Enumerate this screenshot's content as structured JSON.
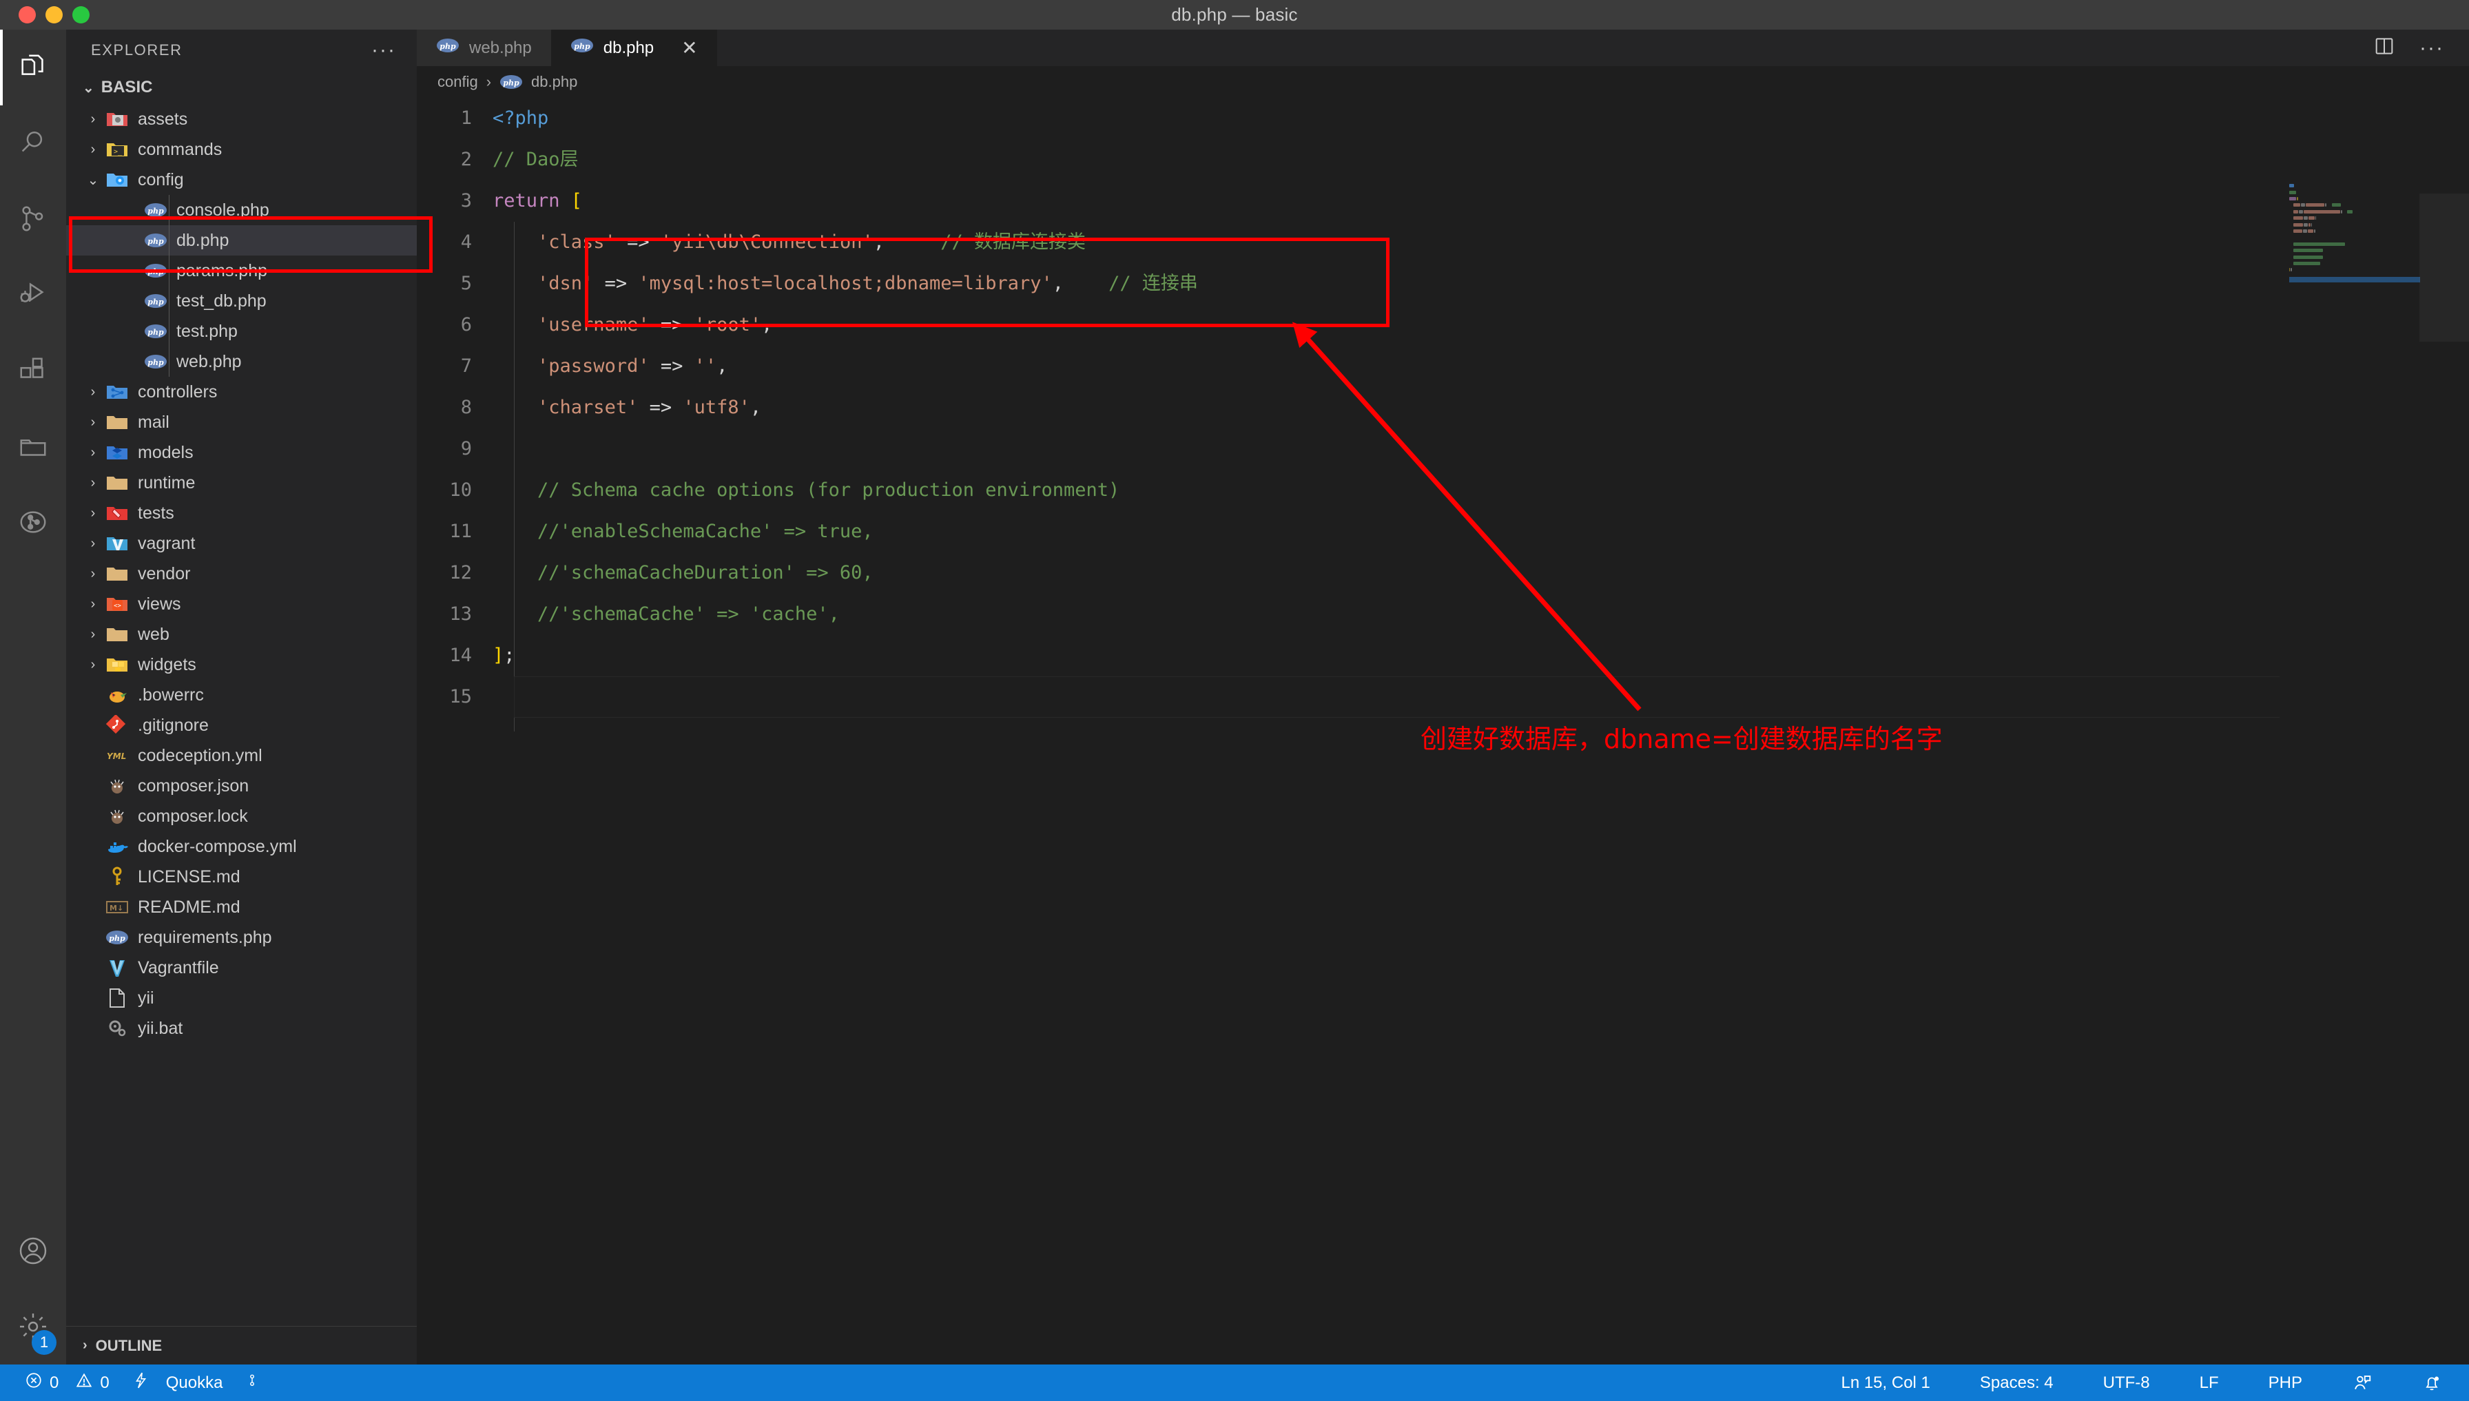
{
  "window": {
    "title": "db.php — basic",
    "traffic_lights": [
      "close",
      "minimize",
      "zoom"
    ]
  },
  "activity_bar": {
    "items": [
      {
        "name": "explorer",
        "icon": "files-icon",
        "active": true
      },
      {
        "name": "search",
        "icon": "search-icon",
        "active": false
      },
      {
        "name": "source-control",
        "icon": "source-control-icon",
        "active": false
      },
      {
        "name": "run-and-debug",
        "icon": "run-debug-icon",
        "active": false
      },
      {
        "name": "extensions",
        "icon": "extensions-icon",
        "active": false
      },
      {
        "name": "file-browser",
        "icon": "folder-icon",
        "active": false
      },
      {
        "name": "git-graph",
        "icon": "git-graph-icon",
        "active": false
      }
    ],
    "bottom_items": [
      {
        "name": "accounts",
        "icon": "account-icon"
      },
      {
        "name": "manage-settings",
        "icon": "gear-icon",
        "badge": "1"
      }
    ]
  },
  "sidebar": {
    "header_label": "EXPLORER",
    "more_actions": "···",
    "section_label": "BASIC",
    "section_chevron": "⌄",
    "outline_label": "OUTLINE",
    "outline_chevron": "›",
    "tree": [
      {
        "label": "assets",
        "type": "folder",
        "depth": 1,
        "chevron": "›",
        "icon": "assets-folder-icon",
        "color": "#e05252"
      },
      {
        "label": "commands",
        "type": "folder",
        "depth": 1,
        "chevron": "›",
        "icon": "commands-folder-icon",
        "color": "#e8c547"
      },
      {
        "label": "config",
        "type": "folder",
        "depth": 1,
        "chevron": "⌄",
        "icon": "config-folder-icon",
        "color": "#64b5f6"
      },
      {
        "label": "console.php",
        "type": "file",
        "depth": 2,
        "chevron": "",
        "icon": "php-icon",
        "color": "#6181b6"
      },
      {
        "label": "db.php",
        "type": "file",
        "depth": 2,
        "chevron": "",
        "icon": "php-icon",
        "color": "#6181b6",
        "selected": true
      },
      {
        "label": "params.php",
        "type": "file",
        "depth": 2,
        "chevron": "",
        "icon": "php-icon",
        "color": "#6181b6"
      },
      {
        "label": "test_db.php",
        "type": "file",
        "depth": 2,
        "chevron": "",
        "icon": "php-icon",
        "color": "#6181b6"
      },
      {
        "label": "test.php",
        "type": "file",
        "depth": 2,
        "chevron": "",
        "icon": "php-icon",
        "color": "#6181b6"
      },
      {
        "label": "web.php",
        "type": "file",
        "depth": 2,
        "chevron": "",
        "icon": "php-icon",
        "color": "#6181b6"
      },
      {
        "label": "controllers",
        "type": "folder",
        "depth": 1,
        "chevron": "›",
        "icon": "controllers-folder-icon",
        "color": "#4a90d9"
      },
      {
        "label": "mail",
        "type": "folder",
        "depth": 1,
        "chevron": "›",
        "icon": "folder-icon",
        "color": "#dcb67a"
      },
      {
        "label": "models",
        "type": "folder",
        "depth": 1,
        "chevron": "›",
        "icon": "models-folder-icon",
        "color": "#3a7bd5"
      },
      {
        "label": "runtime",
        "type": "folder",
        "depth": 1,
        "chevron": "›",
        "icon": "folder-icon",
        "color": "#dcb67a"
      },
      {
        "label": "tests",
        "type": "folder",
        "depth": 1,
        "chevron": "›",
        "icon": "tests-folder-icon",
        "color": "#e53935"
      },
      {
        "label": "vagrant",
        "type": "folder",
        "depth": 1,
        "chevron": "›",
        "icon": "vagrant-folder-icon",
        "color": "#3fa2d6"
      },
      {
        "label": "vendor",
        "type": "folder",
        "depth": 1,
        "chevron": "›",
        "icon": "folder-icon",
        "color": "#dcb67a"
      },
      {
        "label": "views",
        "type": "folder",
        "depth": 1,
        "chevron": "›",
        "icon": "views-folder-icon",
        "color": "#e8603c"
      },
      {
        "label": "web",
        "type": "folder",
        "depth": 1,
        "chevron": "›",
        "icon": "folder-icon",
        "color": "#dcb67a"
      },
      {
        "label": "widgets",
        "type": "folder",
        "depth": 1,
        "chevron": "›",
        "icon": "widgets-folder-icon",
        "color": "#f0c040"
      },
      {
        "label": ".bowerrc",
        "type": "file",
        "depth": 1,
        "chevron": "",
        "icon": "bower-icon",
        "color": "#ef5734"
      },
      {
        "label": ".gitignore",
        "type": "file",
        "depth": 1,
        "chevron": "",
        "icon": "git-icon",
        "color": "#e8432f"
      },
      {
        "label": "codeception.yml",
        "type": "file",
        "depth": 1,
        "chevron": "",
        "icon": "yaml-icon",
        "color": "#cfa847"
      },
      {
        "label": "composer.json",
        "type": "file",
        "depth": 1,
        "chevron": "",
        "icon": "composer-icon",
        "color": "#886a54"
      },
      {
        "label": "composer.lock",
        "type": "file",
        "depth": 1,
        "chevron": "",
        "icon": "composer-icon",
        "color": "#886a54"
      },
      {
        "label": "docker-compose.yml",
        "type": "file",
        "depth": 1,
        "chevron": "",
        "icon": "docker-icon",
        "color": "#2496ed"
      },
      {
        "label": "LICENSE.md",
        "type": "file",
        "depth": 1,
        "chevron": "",
        "icon": "key-icon",
        "color": "#d4a017"
      },
      {
        "label": "README.md",
        "type": "file",
        "depth": 1,
        "chevron": "",
        "icon": "markdown-icon",
        "color": "#9a7b4f"
      },
      {
        "label": "requirements.php",
        "type": "file",
        "depth": 1,
        "chevron": "",
        "icon": "php-icon",
        "color": "#6181b6"
      },
      {
        "label": "Vagrantfile",
        "type": "file",
        "depth": 1,
        "chevron": "",
        "icon": "vagrant-icon",
        "color": "#3fa2d6"
      },
      {
        "label": "yii",
        "type": "file",
        "depth": 1,
        "chevron": "",
        "icon": "plain-file-icon",
        "color": "#c5c5c5"
      },
      {
        "label": "yii.bat",
        "type": "file",
        "depth": 1,
        "chevron": "",
        "icon": "settings-file-icon",
        "color": "#9a9a9a"
      }
    ]
  },
  "editor": {
    "tabs": [
      {
        "label": "web.php",
        "icon": "php-icon",
        "active": false,
        "closable": false
      },
      {
        "label": "db.php",
        "icon": "php-icon",
        "active": true,
        "closable": true,
        "close_glyph": "✕"
      }
    ],
    "tab_actions": [
      {
        "name": "split-editor",
        "icon": "split-editor-icon"
      },
      {
        "name": "more-actions",
        "icon": "ellipsis-icon",
        "glyph": "···"
      }
    ],
    "breadcrumb": [
      {
        "label": "config",
        "icon": ""
      },
      {
        "label": "db.php",
        "icon": "php-icon"
      }
    ],
    "breadcrumb_separator": "›",
    "lines": [
      {
        "n": "1",
        "tokens": [
          {
            "t": "<?php",
            "c": "php-tag"
          }
        ]
      },
      {
        "n": "2",
        "tokens": [
          {
            "t": "// Dao层",
            "c": "cmt"
          }
        ]
      },
      {
        "n": "3",
        "tokens": [
          {
            "t": "return ",
            "c": "kw"
          },
          {
            "t": "[",
            "c": "brk"
          }
        ]
      },
      {
        "n": "4",
        "tokens": [
          {
            "t": "    ",
            "c": "plain"
          },
          {
            "t": "'class'",
            "c": "str"
          },
          {
            "t": " => ",
            "c": "op"
          },
          {
            "t": "'yii\\db\\Connection'",
            "c": "str"
          },
          {
            "t": ",",
            "c": "op"
          },
          {
            "t": "     ",
            "c": "plain"
          },
          {
            "t": "// 数据库连接类",
            "c": "cmt"
          }
        ]
      },
      {
        "n": "5",
        "tokens": [
          {
            "t": "    ",
            "c": "plain"
          },
          {
            "t": "'dsn'",
            "c": "str"
          },
          {
            "t": " => ",
            "c": "op"
          },
          {
            "t": "'mysql:host=localhost;dbname=library'",
            "c": "str"
          },
          {
            "t": ",",
            "c": "op"
          },
          {
            "t": "    ",
            "c": "plain"
          },
          {
            "t": "// 连接串",
            "c": "cmt"
          }
        ]
      },
      {
        "n": "6",
        "tokens": [
          {
            "t": "    ",
            "c": "plain"
          },
          {
            "t": "'username'",
            "c": "str"
          },
          {
            "t": " => ",
            "c": "op"
          },
          {
            "t": "'root'",
            "c": "str"
          },
          {
            "t": ",",
            "c": "op"
          }
        ]
      },
      {
        "n": "7",
        "tokens": [
          {
            "t": "    ",
            "c": "plain"
          },
          {
            "t": "'password'",
            "c": "str"
          },
          {
            "t": " => ",
            "c": "op"
          },
          {
            "t": "''",
            "c": "str"
          },
          {
            "t": ",",
            "c": "op"
          }
        ]
      },
      {
        "n": "8",
        "tokens": [
          {
            "t": "    ",
            "c": "plain"
          },
          {
            "t": "'charset'",
            "c": "str"
          },
          {
            "t": " => ",
            "c": "op"
          },
          {
            "t": "'utf8'",
            "c": "str"
          },
          {
            "t": ",",
            "c": "op"
          }
        ]
      },
      {
        "n": "9",
        "tokens": []
      },
      {
        "n": "10",
        "tokens": [
          {
            "t": "    ",
            "c": "plain"
          },
          {
            "t": "// Schema cache options (for production environment)",
            "c": "cmt"
          }
        ]
      },
      {
        "n": "11",
        "tokens": [
          {
            "t": "    ",
            "c": "plain"
          },
          {
            "t": "//'enableSchemaCache' => true,",
            "c": "cmt"
          }
        ]
      },
      {
        "n": "12",
        "tokens": [
          {
            "t": "    ",
            "c": "plain"
          },
          {
            "t": "//'schemaCacheDuration' => 60,",
            "c": "cmt"
          }
        ]
      },
      {
        "n": "13",
        "tokens": [
          {
            "t": "    ",
            "c": "plain"
          },
          {
            "t": "//'schemaCache' => 'cache',",
            "c": "cmt"
          }
        ]
      },
      {
        "n": "14",
        "tokens": [
          {
            "t": "]",
            "c": "brk"
          },
          {
            "t": ";",
            "c": "op"
          }
        ]
      },
      {
        "n": "15",
        "tokens": []
      }
    ]
  },
  "annotations": {
    "sidebar_box": {
      "name": "db-php-highlight-box",
      "color": "#ff0000"
    },
    "code_box": {
      "name": "dsn-line-highlight-box",
      "color": "#ff0000"
    },
    "arrow": {
      "name": "dsn-callout-arrow",
      "color": "#ff0000"
    },
    "note": "创建好数据库，dbname=创建数据库的名字"
  },
  "statusbar": {
    "left": [
      {
        "name": "problems",
        "icon": "error-icon",
        "label": "0",
        "second_icon": "warning-icon",
        "second_label": "0"
      },
      {
        "name": "quokka",
        "icon": "bolt-icon",
        "label": "Quokka"
      },
      {
        "name": "live-share",
        "icon": "live-share-icon",
        "label": ""
      }
    ],
    "right": [
      {
        "name": "cursor-position",
        "label": "Ln 15, Col 1"
      },
      {
        "name": "indentation",
        "label": "Spaces: 4"
      },
      {
        "name": "encoding",
        "label": "UTF-8"
      },
      {
        "name": "eol",
        "label": "LF"
      },
      {
        "name": "language-mode",
        "label": "PHP"
      },
      {
        "name": "feedback",
        "label": "",
        "icon": "feedback-icon"
      },
      {
        "name": "notifications",
        "label": "",
        "icon": "bell-icon"
      }
    ]
  },
  "colors": {
    "accent": "#0e7ad4",
    "annotation": "#ff0000",
    "editor_bg": "#1e1e1e",
    "sidebar_bg": "#252526",
    "activitybar_bg": "#333333",
    "titlebar_bg": "#3c3c3c"
  }
}
